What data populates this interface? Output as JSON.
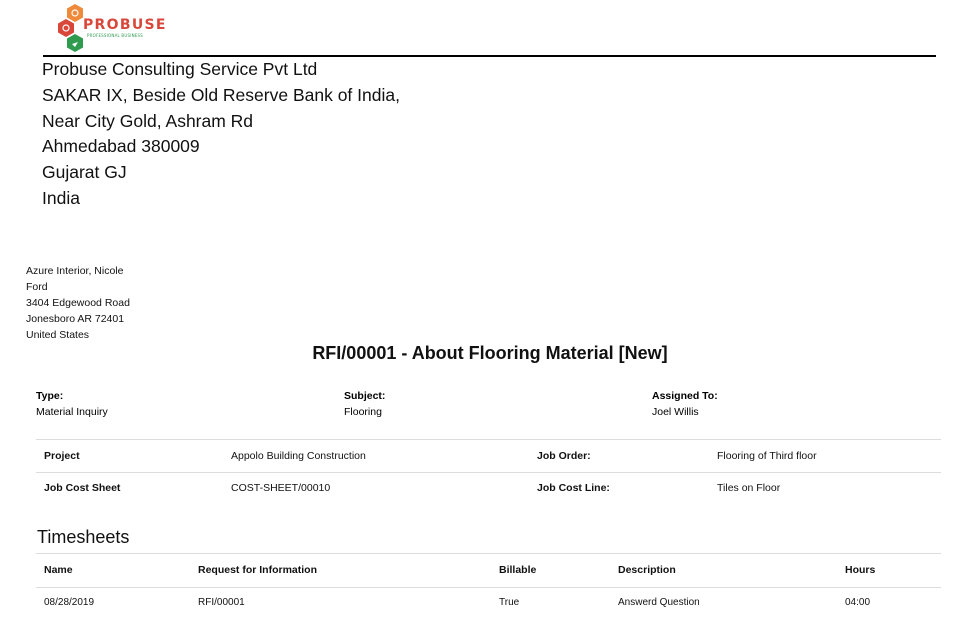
{
  "logo": {
    "text": "PROBUSE",
    "subtext": "PROFESSIONAL BUSINESS"
  },
  "company": {
    "lines": [
      "Probuse Consulting Service Pvt Ltd",
      "SAKAR IX, Beside Old Reserve Bank of India,",
      "Near City Gold, Ashram Rd",
      "Ahmedabad 380009",
      "Gujarat GJ",
      "India"
    ]
  },
  "customer": {
    "lines": [
      "Azure Interior, Nicole",
      "Ford",
      "3404 Edgewood Road",
      "Jonesboro AR 72401",
      "United States"
    ]
  },
  "title": "RFI/00001 - About Flooring Material [New]",
  "meta": {
    "type_label": "Type:",
    "type_value": "Material Inquiry",
    "subject_label": "Subject:",
    "subject_value": "Flooring",
    "assigned_label": "Assigned To:",
    "assigned_value": "Joel Willis"
  },
  "details": {
    "project_label": "Project",
    "project_value": "Appolo Building Construction",
    "job_order_label": "Job Order:",
    "job_order_value": "Flooring of Third floor",
    "job_cost_sheet_label": "Job Cost Sheet",
    "job_cost_sheet_value": "COST-SHEET/00010",
    "job_cost_line_label": "Job Cost Line:",
    "job_cost_line_value": "Tiles on Floor"
  },
  "timesheets": {
    "title": "Timesheets",
    "headers": [
      "Name",
      "Request for Information",
      "Billable",
      "Description",
      "Hours"
    ],
    "rows": [
      [
        "08/28/2019",
        "RFI/00001",
        "True",
        "Answerd Question",
        "04:00"
      ]
    ]
  },
  "colors": {
    "logo_red": "#d9473b",
    "logo_orange": "#ef8a3a",
    "logo_green": "#2e9b4e",
    "rule": "#000000",
    "divider": "#dcdcdc"
  }
}
